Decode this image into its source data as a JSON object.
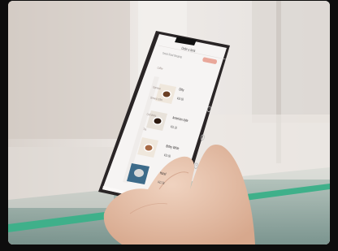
{
  "photo": {
    "subject": "hand-holding-smartphone",
    "colors": {
      "background": "#e9e5e2",
      "phone_frame": "#2a2526",
      "screen": "#f6f4f3",
      "skin": "#e7c5ae",
      "accent": "#e9a79a",
      "green_trim": "#3fb08a"
    }
  },
  "screen": {
    "title": "Order a drink",
    "store": "Dream Road Shopping",
    "pill": "",
    "categories": [
      "Coffee",
      "Espresso",
      "Brewed coffee",
      "Cold drinks",
      "Tea"
    ],
    "items": [
      {
        "name": "Dirty",
        "price": "¥35.68"
      },
      {
        "name": "American style",
        "price": "¥31.36"
      },
      {
        "name": "Brdey White",
        "price": "¥25.68"
      },
      {
        "name": "Hazel",
        "price": "¥31.38"
      }
    ],
    "cart_total": ""
  }
}
